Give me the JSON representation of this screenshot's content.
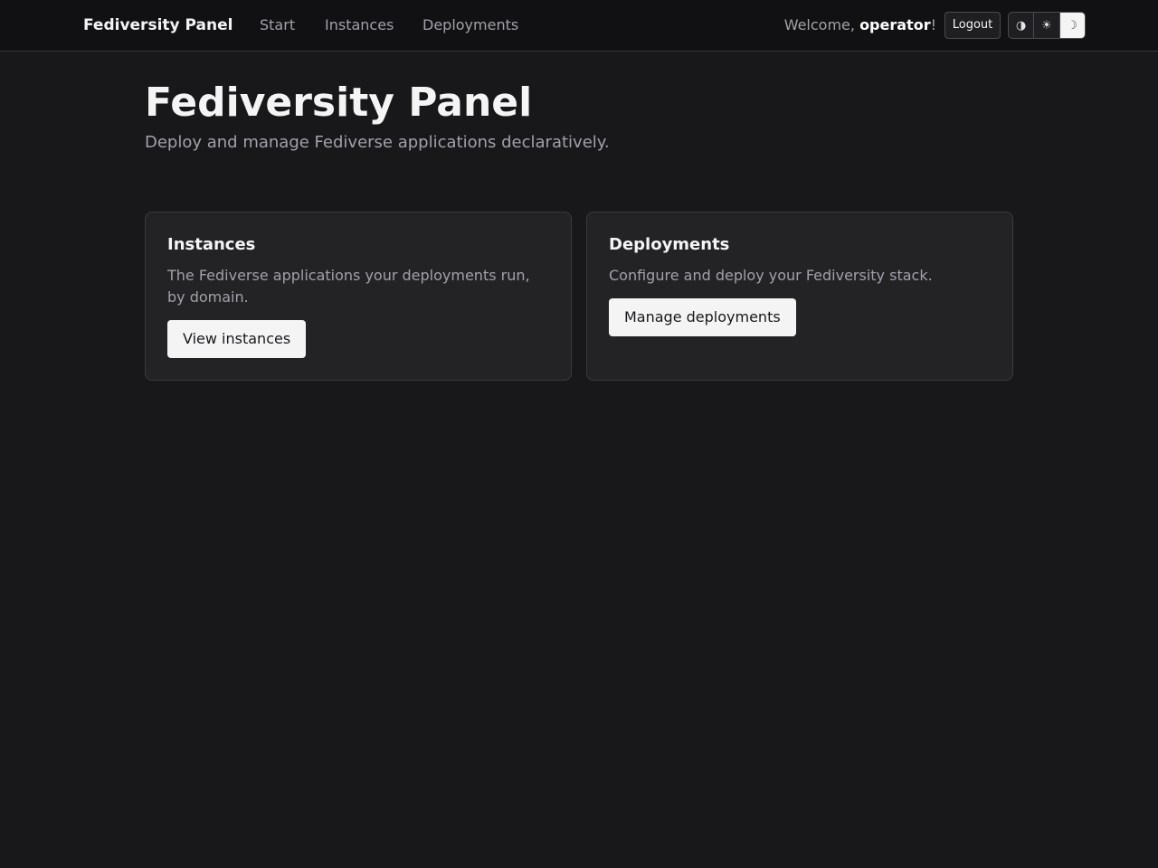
{
  "nav": {
    "brand": "Fediversity Panel",
    "links": [
      "Start",
      "Instances",
      "Deployments"
    ],
    "welcome_prefix": "Welcome, ",
    "username": "operator",
    "welcome_suffix": "!",
    "logout_label": "Logout",
    "theme_buttons": [
      {
        "icon": "contrast-icon",
        "glyph": "◑"
      },
      {
        "icon": "sun-icon",
        "glyph": "☀"
      },
      {
        "icon": "moon-icon",
        "glyph": "☽"
      }
    ],
    "active_theme_index": 2
  },
  "hero": {
    "title": "Fediversity Panel",
    "subtitle": "Deploy and manage Fediverse applications declaratively."
  },
  "cards": [
    {
      "title": "Instances",
      "description": "The Fediverse applications your deployments run, by domain.",
      "button_label": "View instances"
    },
    {
      "title": "Deployments",
      "description": "Configure and deploy your Fediversity stack.",
      "button_label": "Manage deployments"
    }
  ],
  "colors": {
    "background": "#18181b",
    "nav_background": "#111113",
    "card_background": "#232326",
    "primary_button": "#f4f4f5",
    "muted_text": "#a1a1aa"
  }
}
